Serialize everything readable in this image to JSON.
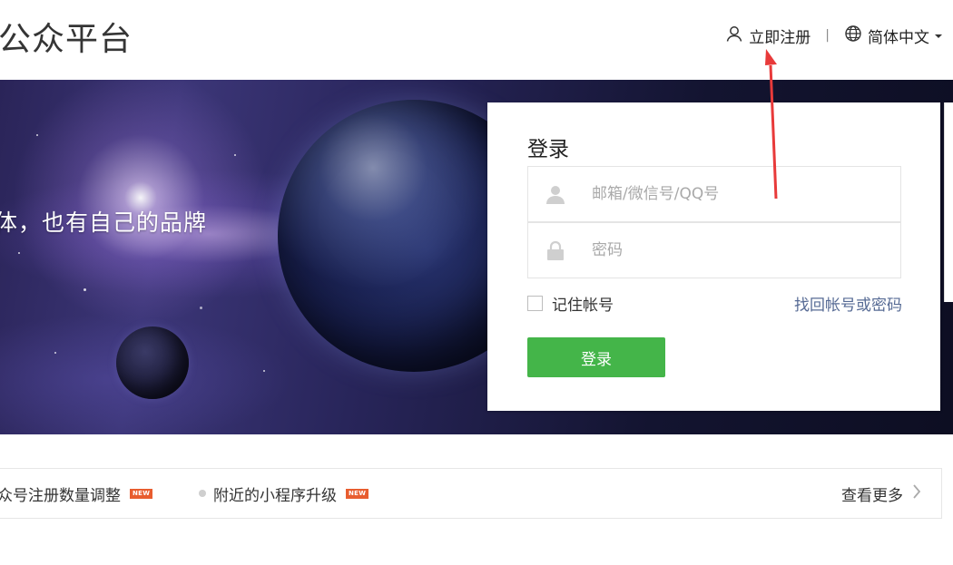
{
  "header": {
    "brand": "公众平台",
    "register_label": "立即注册",
    "separator": "|",
    "language_label": "简体中文"
  },
  "banner": {
    "slogan": "体，也有自己的品牌"
  },
  "login": {
    "title": "登录",
    "account_placeholder": "邮箱/微信号/QQ号",
    "password_placeholder": "密码",
    "remember_label": "记住帐号",
    "forgot_link": "找回帐号或密码",
    "submit_label": "登录"
  },
  "news": {
    "items": [
      {
        "text": "众号注册数量调整",
        "badge": "NEW"
      },
      {
        "text": "附近的小程序升级",
        "badge": "NEW"
      }
    ],
    "more_label": "查看更多"
  },
  "colors": {
    "primary_button": "#44b549",
    "link": "#576b95",
    "badge": "#e85d2f",
    "annotation_arrow": "#e83a3a"
  },
  "icons": [
    "user-icon",
    "globe-icon",
    "chevron-down-icon",
    "lock-icon",
    "chevron-right-icon"
  ]
}
